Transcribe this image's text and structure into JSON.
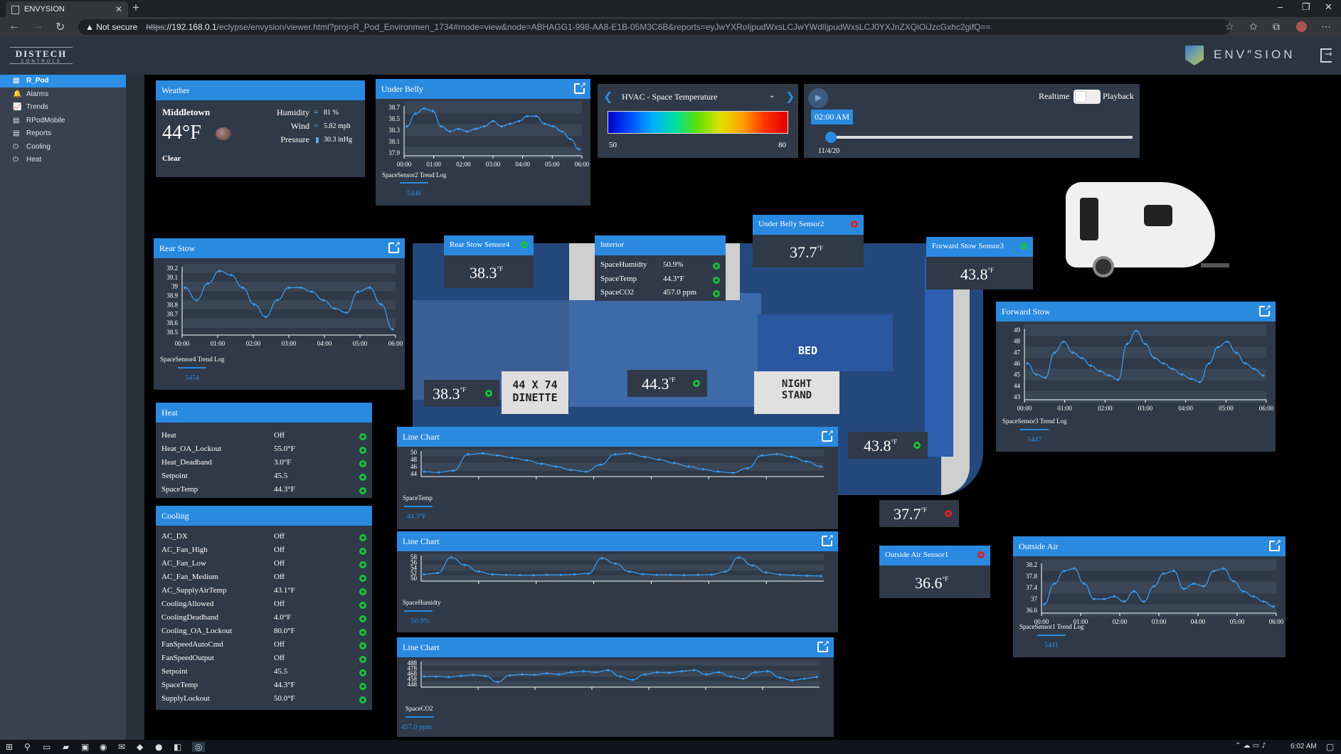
{
  "browser": {
    "tab_title": "ENVYSION",
    "new_tab": "+",
    "security": "Not secure",
    "url_scheme": "https",
    "url_host": "://192.168.0.1",
    "url_rest": "/eclypse/envysion/viewer.html?proj=R_Pod_Environmen_1734#mode=view&node=ABHAGG1-998-AA8-E1B-05M3C6B&reports=eyJwYXRoIjpudWxsLCJwYWdlIjpudWxsLCJ0YXJnZXQiOiJzcGxhc2gifQ==",
    "minimize": "–",
    "maximize": "❐",
    "close": "✕",
    "back": "←",
    "forward": "→",
    "reload": "↻"
  },
  "app": {
    "brand_line1": "DISTECH",
    "brand_line2": "CONTROLS",
    "logo_text": "ENV″SION",
    "logout_icon": "logout-icon"
  },
  "sidebar": {
    "items": [
      {
        "label": "R_Pod",
        "icon": "▤"
      },
      {
        "label": "Alarms",
        "icon": "🔔"
      },
      {
        "label": "Trends",
        "icon": "📈"
      },
      {
        "label": "RPodMobile",
        "icon": "▤"
      },
      {
        "label": "Reports",
        "icon": "▤"
      },
      {
        "label": "Cooling",
        "icon": "⏻"
      },
      {
        "label": "Heat",
        "icon": "⏻"
      }
    ]
  },
  "weather": {
    "title": "Weather",
    "city": "Middletown",
    "temp": "44°F",
    "condition": "Clear",
    "humidity_label": "Humidity",
    "humidity": "81 %",
    "wind_label": "Wind",
    "wind": "5.82 mph",
    "pressure_label": "Pressure",
    "pressure": "30.3 inHg"
  },
  "underbelly": {
    "title": "Under Belly",
    "caption": "SpaceSensor2 Trend Log",
    "value": "5446"
  },
  "hvac": {
    "title": "HVAC - Space Temperature",
    "min": "50",
    "max": "80"
  },
  "playback": {
    "time": "02:00 AM",
    "date": "11/4/20",
    "realtime": "Realtime",
    "playback": "Playback"
  },
  "rearstow": {
    "title": "Rear Stow",
    "caption": "SpaceSensor4 Trend Log",
    "value": "5454"
  },
  "forwardstow": {
    "title": "Forward Stow",
    "caption": "SpaceSensor3 Trend Log",
    "value": "5447"
  },
  "outsideair": {
    "title": "Outside Air",
    "caption": "SpaceSensor1 Trend Log",
    "value": "5441"
  },
  "interior": {
    "title": "Interior",
    "rows": [
      {
        "k": "SpaceHumidty",
        "v": "50.9%"
      },
      {
        "k": "SpaceTemp",
        "v": "44.3°F"
      },
      {
        "k": "SpaceCO2",
        "v": "457.0 ppm"
      }
    ]
  },
  "tiles": {
    "rear4": {
      "title": "Rear Stow Sensor4",
      "value": "38.3"
    },
    "under2": {
      "title": "Under Belly Sensor2",
      "value": "37.7"
    },
    "fwd3": {
      "title": "Forward Stow Sensor3",
      "value": "43.8"
    },
    "out1": {
      "title": "Outside Air Sensor1",
      "value": "36.6"
    },
    "unit": "°F",
    "floor1": "38.3",
    "floor2": "44.3",
    "floor3": "43.8",
    "floor4": "37.7"
  },
  "floor": {
    "dinette": "44 X 74\nDINETTE",
    "nightstand": "NIGHT\nSTAND",
    "bed": "BED"
  },
  "heat": {
    "title": "Heat",
    "rows": [
      {
        "k": "Heat",
        "v": "Off"
      },
      {
        "k": "Heat_OA_Lockout",
        "v": "55.0°F"
      },
      {
        "k": "Heat_Deadband",
        "v": "3.0°F"
      },
      {
        "k": "Setpoint",
        "v": "45.5"
      },
      {
        "k": "SpaceTemp",
        "v": "44.3°F"
      }
    ]
  },
  "cooling": {
    "title": "Cooling",
    "rows": [
      {
        "k": "AC_DX",
        "v": "Off"
      },
      {
        "k": "AC_Fan_High",
        "v": "Off"
      },
      {
        "k": "AC_Fan_Low",
        "v": "Off"
      },
      {
        "k": "AC_Fan_Medium",
        "v": "Off"
      },
      {
        "k": "AC_SupplyAirTemp",
        "v": "43.1°F"
      },
      {
        "k": "CoolingAllowed",
        "v": "Off"
      },
      {
        "k": "CoolingDeadband",
        "v": "4.0°F"
      },
      {
        "k": "Cooling_OA_Lockout",
        "v": "80.0°F"
      },
      {
        "k": "FanSpeedAutoCmd",
        "v": "Off"
      },
      {
        "k": "FanSpeedOutput",
        "v": "Off"
      },
      {
        "k": "Setpoint",
        "v": "45.5"
      },
      {
        "k": "SpaceTemp",
        "v": "44.3°F"
      },
      {
        "k": "SupplyLockout",
        "v": "50.0°F"
      }
    ]
  },
  "lc1": {
    "title": "Line Chart",
    "caption": "SpaceTemp",
    "value": "44.3°F"
  },
  "lc2": {
    "title": "Line Chart",
    "caption": "SpaceHumidty",
    "value": "50.9%"
  },
  "lc3": {
    "title": "Line Chart",
    "caption": "SpaceCO2",
    "value": "457.0 ppm"
  },
  "taskbar": {
    "time": "6:02 AM"
  },
  "chart_data": [
    {
      "id": "underbelly",
      "type": "line",
      "x": [
        "00:00",
        "01:00",
        "02:00",
        "03:00",
        "04:00",
        "05:00",
        "06:00"
      ],
      "yticks": [
        "38.7",
        "38.5",
        "38.3",
        "38.1",
        "37.9"
      ],
      "ylim": [
        37.85,
        38.8
      ],
      "values": [
        38.4,
        38.65,
        38.75,
        38.7,
        38.4,
        38.3,
        38.35,
        38.3,
        38.35,
        38.4,
        38.5,
        38.4,
        38.45,
        38.5,
        38.6,
        38.6,
        38.45,
        38.4,
        38.3,
        38.15,
        37.95
      ]
    },
    {
      "id": "rearstow",
      "type": "line",
      "x": [
        "00:00",
        "01:00",
        "02:00",
        "03:00",
        "04:00",
        "05:00",
        "06:00"
      ],
      "yticks": [
        "39.2",
        "39.1",
        "39",
        "38.9",
        "38.8",
        "38.7",
        "38.6",
        "38.5"
      ],
      "ylim": [
        38.45,
        39.25
      ],
      "values": [
        39.0,
        38.85,
        39.05,
        39.2,
        39.15,
        39.0,
        38.8,
        38.65,
        38.85,
        39.0,
        39.0,
        38.95,
        38.85,
        38.75,
        38.7,
        38.95,
        39.0,
        38.8,
        38.5
      ]
    },
    {
      "id": "forwardstow",
      "type": "line",
      "x": [
        "00:00",
        "01:00",
        "02:00",
        "03:00",
        "04:00",
        "05:00",
        "06:00"
      ],
      "yticks": [
        "49",
        "48",
        "47",
        "46",
        "45",
        "44",
        "43"
      ],
      "ylim": [
        42.8,
        49.2
      ],
      "values": [
        46,
        45,
        44.7,
        47,
        48,
        47,
        46.5,
        45.8,
        45.3,
        44.9,
        44.5,
        47.8,
        49,
        47.8,
        46.5,
        46,
        45.5,
        45,
        44.6,
        44.3,
        46,
        47.5,
        48,
        47,
        46,
        45.5,
        44.9
      ]
    },
    {
      "id": "outsideair",
      "type": "line",
      "x": [
        "00:00",
        "01:00",
        "02:00",
        "03:00",
        "04:00",
        "05:00",
        "06:00"
      ],
      "yticks": [
        "38.2",
        "37.8",
        "37.4",
        "37",
        "36.6"
      ],
      "ylim": [
        36.5,
        38.4
      ],
      "values": [
        36.8,
        37.6,
        38.1,
        38.2,
        37.6,
        37.0,
        37.0,
        37.1,
        36.9,
        37.3,
        36.9,
        37.5,
        38.0,
        38.1,
        37.4,
        37.6,
        37.5,
        38.1,
        38.2,
        37.7,
        37.3,
        37.1,
        36.9,
        36.7
      ]
    },
    {
      "id": "lc1",
      "type": "line",
      "yticks": [
        "50",
        "48",
        "46",
        "44"
      ],
      "ylim": [
        43.5,
        50.5
      ],
      "values": [
        44.5,
        44.3,
        44.8,
        49.5,
        49.8,
        49.2,
        48.5,
        47.8,
        46.8,
        46.0,
        45.0,
        44.5,
        46.5,
        49.5,
        49.8,
        48.8,
        48,
        47,
        46,
        45.2,
        44.5,
        44.2,
        45.5,
        49.2,
        49.6,
        48.8,
        47.5,
        46
      ]
    },
    {
      "id": "lc2",
      "type": "line",
      "yticks": [
        "58",
        "56",
        "54",
        "52",
        "50"
      ],
      "ylim": [
        49.5,
        58.5
      ],
      "values": [
        51.5,
        52,
        57.8,
        55,
        52.5,
        51.5,
        51.3,
        51.2,
        51.2,
        51.3,
        51.3,
        51.5,
        51.8,
        57.5,
        55.5,
        52.5,
        51.6,
        51.3,
        51.3,
        51.2,
        51.3,
        51.4,
        52.5,
        57.8,
        54.8,
        52.2,
        51.4,
        51.2,
        51.0,
        50.9
      ]
    },
    {
      "id": "lc3",
      "type": "line",
      "yticks": [
        "488",
        "478",
        "468",
        "458",
        "448"
      ],
      "ylim": [
        445,
        490
      ],
      "values": [
        462,
        462,
        461,
        463,
        465,
        463,
        452,
        464,
        466,
        465,
        468,
        466,
        470,
        472,
        470,
        474,
        462,
        456,
        466,
        470,
        469,
        472,
        474,
        466,
        470,
        462,
        458,
        470,
        472,
        460,
        455,
        458,
        461
      ]
    }
  ]
}
